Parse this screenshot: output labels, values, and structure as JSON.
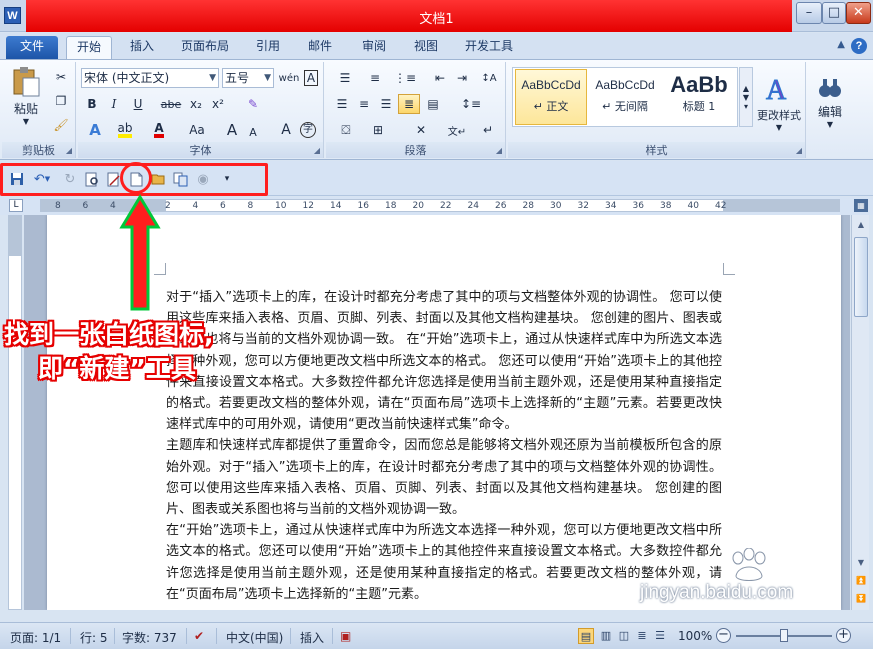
{
  "window": {
    "title": "文档1",
    "app_icon": "W",
    "min": "–",
    "max": "□",
    "close": "✕"
  },
  "tabs": [
    {
      "label": "文件"
    },
    {
      "label": "开始"
    },
    {
      "label": "插入"
    },
    {
      "label": "页面布局"
    },
    {
      "label": "引用"
    },
    {
      "label": "邮件"
    },
    {
      "label": "审阅"
    },
    {
      "label": "视图"
    },
    {
      "label": "开发工具"
    }
  ],
  "ribbon": {
    "clipboard": {
      "label": "剪贴板",
      "paste": "粘贴"
    },
    "font": {
      "label": "字体",
      "font_name": "宋体 (中文正文)",
      "font_size": "五号",
      "bold": "B",
      "italic": "I",
      "underline": "U",
      "strike": "abe",
      "sub": "x₂",
      "sup": "x²",
      "grow": "A",
      "shrink": "A",
      "aa": "Aa",
      "clear": "A"
    },
    "paragraph": {
      "label": "段落"
    },
    "styles": {
      "label": "样式",
      "items": [
        {
          "sample": "AaBbCcDd",
          "name": "↵ 正文"
        },
        {
          "sample": "AaBbCcDd",
          "name": "↵ 无间隔"
        },
        {
          "sample": "AaBb",
          "name": "标题 1"
        }
      ],
      "change_styles": "更改样式"
    },
    "editing": {
      "label": "编辑"
    }
  },
  "ruler": {
    "numbers": [
      "8",
      "6",
      "4",
      "2",
      "2",
      "4",
      "6",
      "8",
      "10",
      "12",
      "14",
      "16",
      "18",
      "20",
      "22",
      "24",
      "26",
      "28",
      "30",
      "32",
      "34",
      "36",
      "38",
      "40",
      "42"
    ]
  },
  "document": {
    "paragraphs": [
      "对于“插入”选项卡上的库，在设计时都充分考虑了其中的项与文档整体外观的协调性。 您可以使用这些库来插入表格、页眉、页脚、列表、封面以及其他文档构建基块。 您创建的图片、图表或关系图也将与当前的文档外观协调一致。 在“开始”选项卡上，通过从快速样式库中为所选文本选择一种外观，您可以方便地更改文档中所选文本的格式。 您还可以使用“开始”选项卡上的其他控件来直接设置文本格式。大多数控件都允许您选择是使用当前主题外观，还是使用某种直接指定的格式。若要更改文档的整体外观，请在“页面布局”选项卡上选择新的“主题”元素。若要更改快速样式库中的可用外观，请使用“更改当前快速样式集”命令。",
      "主题库和快速样式库都提供了重置命令，因而您总是能够将文档外观还原为当前模板所包含的原始外观。对于“插入”选项卡上的库，在设计时都充分考虑了其中的项与文档整体外观的协调性。 您可以使用这些库来插入表格、页眉、页脚、列表、封面以及其他文档构建基块。 您创建的图片、图表或关系图也将与当前的文档外观协调一致。",
      "在“开始”选项卡上，通过从快速样式库中为所选文本选择一种外观，您可以方便地更改文档中所选文本的格式。您还可以使用“开始”选项卡上的其他控件来直接设置文本格式。大多数控件都允许您选择是使用当前主题外观，还是使用某种直接指定的格式。若要更改文档的整体外观，请在“页面布局”选项卡上选择新的“主题”元素。"
    ]
  },
  "statusbar": {
    "page": "页面: 1/1",
    "line": "行: 5",
    "words": "字数: 737",
    "language": "中文(中国)",
    "mode": "插入",
    "zoom": "100%"
  },
  "annotation": {
    "line1": "找到一张白纸图标,",
    "line2": "即“新建”工具"
  },
  "watermark": "jingyan.baidu.com",
  "colors": {
    "annotation": "#ff1e1e",
    "title_bar": "#e40000",
    "file_tab": "#1d55a8"
  }
}
